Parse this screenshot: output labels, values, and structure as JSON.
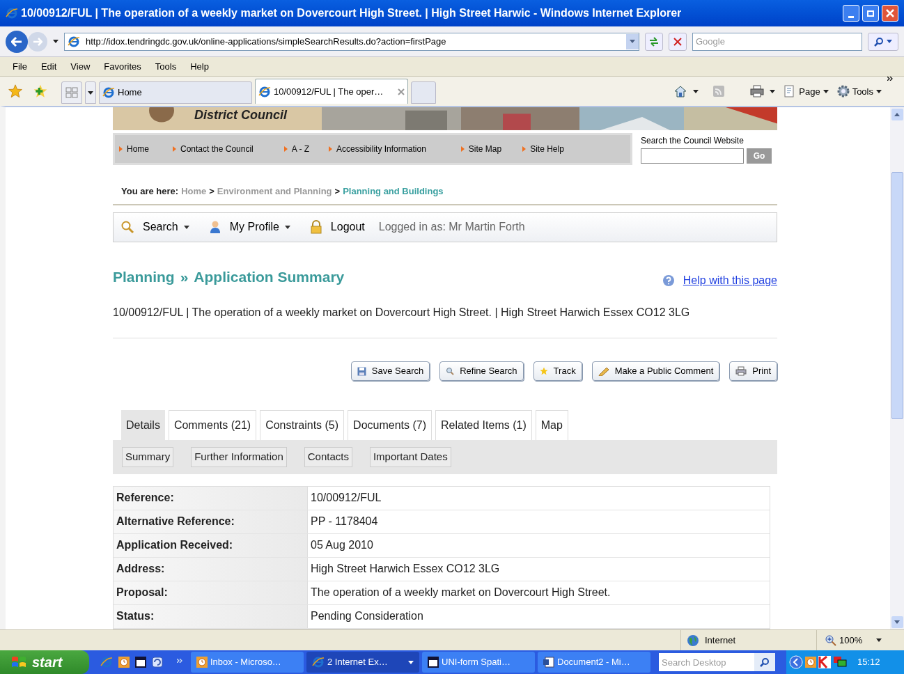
{
  "window": {
    "title": "10/00912/FUL | The operation of a weekly market on Dovercourt High Street. | High Street Harwic - Windows Internet Explorer"
  },
  "address_bar": {
    "url": "http://idox.tendringdc.gov.uk/online-applications/simpleSearchResults.do?action=firstPage",
    "search_placeholder": "Google"
  },
  "menu": [
    "File",
    "Edit",
    "View",
    "Favorites",
    "Tools",
    "Help"
  ],
  "browser_tabs": [
    {
      "label": "Home",
      "selected": false
    },
    {
      "label": "10/00912/FUL | The oper…",
      "selected": true
    }
  ],
  "command_bar": [
    "Page",
    "Tools"
  ],
  "page": {
    "banner_title": "District Council",
    "nav_links": [
      "Home",
      "Contact the Council",
      "A - Z",
      "Accessibility Information",
      "Site Map",
      "Site Help"
    ],
    "site_search": {
      "label": "Search the Council Website",
      "button": "Go"
    },
    "breadcrumb": {
      "label": "You are here:",
      "separator": ">",
      "items": [
        {
          "text": "Home",
          "current": false
        },
        {
          "text": "Environment and Planning",
          "current": false
        },
        {
          "text": "Planning and Buildings",
          "current": true
        }
      ]
    },
    "user_bar": {
      "search": "Search",
      "profile": "My Profile",
      "logout": "Logout",
      "logged_in": "Logged in as: Mr Martin Forth"
    },
    "heading": {
      "section": "Planning",
      "separator": "»",
      "title": "Application Summary"
    },
    "help_link": "Help with this page",
    "description": "10/00912/FUL | The operation of a weekly market on Dovercourt High Street. | High Street Harwich Essex CO12 3LG",
    "actions": [
      {
        "kind": "save",
        "label": "Save Search"
      },
      {
        "kind": "refine",
        "label": "Refine Search"
      },
      {
        "kind": "track",
        "label": "Track"
      },
      {
        "kind": "comment",
        "label": "Make a Public Comment"
      },
      {
        "kind": "print",
        "label": "Print"
      }
    ],
    "tabs": [
      {
        "label": "Details",
        "selected": true
      },
      {
        "label": "Comments (21)",
        "selected": false
      },
      {
        "label": "Constraints (5)",
        "selected": false
      },
      {
        "label": "Documents (7)",
        "selected": false
      },
      {
        "label": "Related Items (1)",
        "selected": false
      },
      {
        "label": "Map",
        "selected": false
      }
    ],
    "subtabs": [
      "Summary",
      "Further Information",
      "Contacts",
      "Important Dates"
    ],
    "details": [
      {
        "label": "Reference:",
        "value": "10/00912/FUL"
      },
      {
        "label": "Alternative Reference:",
        "value": "PP - 1178404"
      },
      {
        "label": "Application Received:",
        "value": "05 Aug 2010"
      },
      {
        "label": "Address:",
        "value": "High Street Harwich Essex CO12 3LG"
      },
      {
        "label": "Proposal:",
        "value": "The operation of a weekly market on Dovercourt High Street."
      },
      {
        "label": "Status:",
        "value": "Pending Consideration"
      }
    ]
  },
  "status_bar": {
    "zone": "Internet",
    "zoom": "100%"
  },
  "taskbar": {
    "start": "start",
    "buttons": [
      {
        "kind": "mail",
        "label": "Inbox - Microso…",
        "selected": false
      },
      {
        "kind": "ie",
        "label": "2 Internet Ex…",
        "selected": true
      },
      {
        "kind": "doc",
        "label": "UNI-form Spati…",
        "selected": false
      },
      {
        "kind": "word",
        "label": "Document2 - Mi…",
        "selected": false
      }
    ],
    "search_placeholder": "Search Desktop",
    "clock": "15:12"
  }
}
